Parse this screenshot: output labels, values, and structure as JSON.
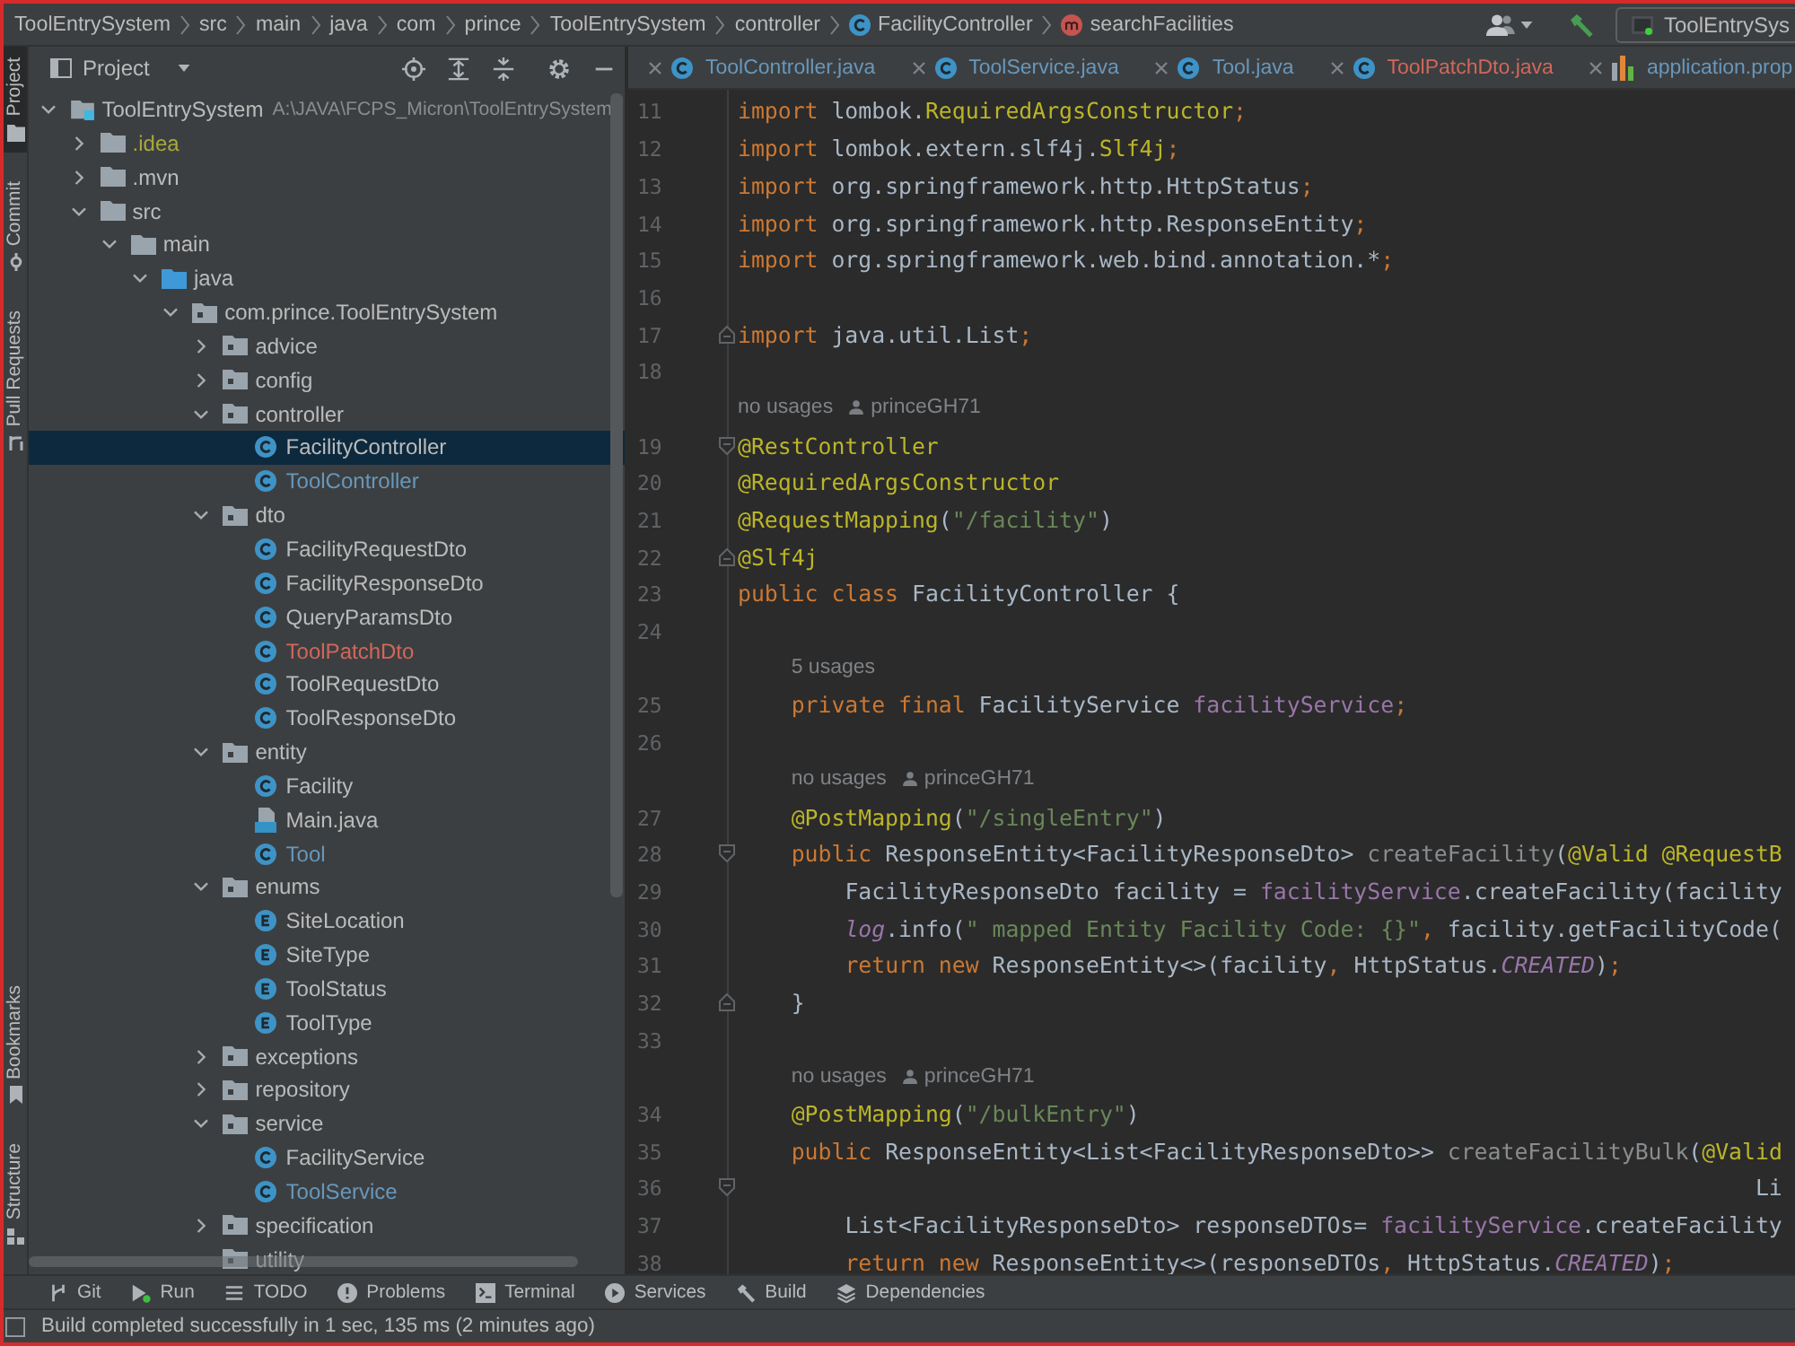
{
  "breadcrumb": {
    "items": [
      {
        "label": "ToolEntrySystem",
        "kind": "path"
      },
      {
        "label": "src",
        "kind": "path"
      },
      {
        "label": "main",
        "kind": "path"
      },
      {
        "label": "java",
        "kind": "path"
      },
      {
        "label": "com",
        "kind": "path"
      },
      {
        "label": "prince",
        "kind": "path"
      },
      {
        "label": "ToolEntrySystem",
        "kind": "path"
      },
      {
        "label": "controller",
        "kind": "path"
      },
      {
        "label": "FacilityController",
        "kind": "class"
      },
      {
        "label": "searchFacilities",
        "kind": "method"
      }
    ],
    "run_configuration": "ToolEntrySys"
  },
  "side_strip": {
    "top": [
      {
        "label": "Project",
        "kind": "project",
        "selected": true
      },
      {
        "label": "Commit",
        "kind": "commit",
        "selected": false
      },
      {
        "label": "Pull Requests",
        "kind": "pull-requests",
        "selected": false
      }
    ],
    "bottom": [
      {
        "label": "Bookmarks",
        "kind": "bookmarks",
        "selected": false
      },
      {
        "label": "Structure",
        "kind": "structure",
        "selected": false
      }
    ]
  },
  "project_panel": {
    "title": "Project",
    "tree": [
      {
        "label": "ToolEntrySystem",
        "path": "A:\\JAVA\\FCPS_Micron\\ToolEntrySystem",
        "kind": "module",
        "expanded": true,
        "selected": false,
        "children": [
          {
            "label": ".idea",
            "kind": "folder",
            "color": "#a8a83a",
            "expanded": false,
            "selected": false
          },
          {
            "label": ".mvn",
            "kind": "folder",
            "expanded": false,
            "selected": false
          },
          {
            "label": "src",
            "kind": "folder",
            "expanded": true,
            "selected": false,
            "children": [
              {
                "label": "main",
                "kind": "folder",
                "expanded": true,
                "selected": false,
                "children": [
                  {
                    "label": "java",
                    "kind": "source-folder",
                    "expanded": true,
                    "selected": false,
                    "children": [
                      {
                        "label": "com.prince.ToolEntrySystem",
                        "kind": "package",
                        "expanded": true,
                        "selected": false,
                        "children": [
                          {
                            "label": "advice",
                            "kind": "package",
                            "expanded": false,
                            "selected": false
                          },
                          {
                            "label": "config",
                            "kind": "package",
                            "expanded": false,
                            "selected": false
                          },
                          {
                            "label": "controller",
                            "kind": "package",
                            "expanded": true,
                            "selected": false,
                            "children": [
                              {
                                "label": "FacilityController",
                                "kind": "class",
                                "selected": true
                              },
                              {
                                "label": "ToolController",
                                "kind": "class",
                                "color": "#6897bb",
                                "selected": false
                              }
                            ]
                          },
                          {
                            "label": "dto",
                            "kind": "package",
                            "expanded": true,
                            "selected": false,
                            "children": [
                              {
                                "label": "FacilityRequestDto",
                                "kind": "class",
                                "selected": false
                              },
                              {
                                "label": "FacilityResponseDto",
                                "kind": "class",
                                "selected": false
                              },
                              {
                                "label": "QueryParamsDto",
                                "kind": "class",
                                "selected": false
                              },
                              {
                                "label": "ToolPatchDto",
                                "kind": "class",
                                "color": "#d1675a",
                                "selected": false
                              },
                              {
                                "label": "ToolRequestDto",
                                "kind": "class",
                                "selected": false
                              },
                              {
                                "label": "ToolResponseDto",
                                "kind": "class",
                                "selected": false
                              }
                            ]
                          },
                          {
                            "label": "entity",
                            "kind": "package",
                            "expanded": true,
                            "selected": false,
                            "children": [
                              {
                                "label": "Facility",
                                "kind": "class",
                                "selected": false
                              },
                              {
                                "label": "Main.java",
                                "kind": "java-file",
                                "selected": false
                              },
                              {
                                "label": "Tool",
                                "kind": "class",
                                "color": "#6897bb",
                                "selected": false
                              }
                            ]
                          },
                          {
                            "label": "enums",
                            "kind": "package",
                            "expanded": true,
                            "selected": false,
                            "children": [
                              {
                                "label": "SiteLocation",
                                "kind": "enum",
                                "selected": false
                              },
                              {
                                "label": "SiteType",
                                "kind": "enum",
                                "selected": false
                              },
                              {
                                "label": "ToolStatus",
                                "kind": "enum",
                                "selected": false
                              },
                              {
                                "label": "ToolType",
                                "kind": "enum",
                                "selected": false
                              }
                            ]
                          },
                          {
                            "label": "exceptions",
                            "kind": "package",
                            "expanded": false,
                            "selected": false
                          },
                          {
                            "label": "repository",
                            "kind": "package",
                            "expanded": false,
                            "selected": false
                          },
                          {
                            "label": "service",
                            "kind": "package",
                            "expanded": true,
                            "selected": false,
                            "children": [
                              {
                                "label": "FacilityService",
                                "kind": "class",
                                "selected": false
                              },
                              {
                                "label": "ToolService",
                                "kind": "class",
                                "color": "#6897bb",
                                "selected": false
                              }
                            ]
                          },
                          {
                            "label": "specification",
                            "kind": "package",
                            "expanded": false,
                            "selected": false
                          },
                          {
                            "label": "utility",
                            "kind": "package",
                            "selected": false
                          }
                        ]
                      }
                    ]
                  }
                ]
              }
            ]
          }
        ]
      }
    ]
  },
  "editor": {
    "tabs": [
      {
        "label": "ToolController.java",
        "kind": "class",
        "color": "#6897bb",
        "selected": false
      },
      {
        "label": "ToolService.java",
        "kind": "class",
        "color": "#6897bb",
        "selected": false
      },
      {
        "label": "Tool.java",
        "kind": "class",
        "color": "#6897bb",
        "selected": false
      },
      {
        "label": "ToolPatchDto.java",
        "kind": "class",
        "color": "#d1675a",
        "selected": false
      },
      {
        "label": "application.prop",
        "kind": "properties",
        "color": "#6897bb",
        "selected": false
      }
    ],
    "lines": [
      {
        "kind": "code",
        "number": "11",
        "tokens": [
          {
            "kind": "kw",
            "text": "import"
          },
          {
            "kind": "plain",
            "text": " lombok."
          },
          {
            "kind": "ann",
            "text": "RequiredArgsConstructor"
          },
          {
            "kind": "kw",
            "text": ";"
          }
        ]
      },
      {
        "kind": "code",
        "number": "12",
        "tokens": [
          {
            "kind": "kw",
            "text": "import"
          },
          {
            "kind": "plain",
            "text": " lombok.extern.slf4j."
          },
          {
            "kind": "ann",
            "text": "Slf4j"
          },
          {
            "kind": "kw",
            "text": ";"
          }
        ]
      },
      {
        "kind": "code",
        "number": "13",
        "tokens": [
          {
            "kind": "kw",
            "text": "import"
          },
          {
            "kind": "plain",
            "text": " org.springframework.http.HttpStatus"
          },
          {
            "kind": "kw",
            "text": ";"
          }
        ]
      },
      {
        "kind": "code",
        "number": "14",
        "tokens": [
          {
            "kind": "kw",
            "text": "import"
          },
          {
            "kind": "plain",
            "text": " org.springframework.http.ResponseEntity"
          },
          {
            "kind": "kw",
            "text": ";"
          }
        ]
      },
      {
        "kind": "code",
        "number": "15",
        "tokens": [
          {
            "kind": "kw",
            "text": "import"
          },
          {
            "kind": "plain",
            "text": " org.springframework.web.bind.annotation.*"
          },
          {
            "kind": "kw",
            "text": ";"
          }
        ]
      },
      {
        "kind": "code",
        "number": "16"
      },
      {
        "kind": "fold-end",
        "number": "17",
        "tokens": [
          {
            "kind": "kw",
            "text": "import"
          },
          {
            "kind": "plain",
            "text": " java.util.List"
          },
          {
            "kind": "kw",
            "text": ";"
          }
        ]
      },
      {
        "kind": "code",
        "number": "18"
      },
      {
        "kind": "hint",
        "usages": "no usages",
        "author": "princeGH71"
      },
      {
        "kind": "fold-start",
        "number": "19",
        "tokens": [
          {
            "kind": "ann",
            "text": "@RestController"
          }
        ]
      },
      {
        "kind": "code",
        "number": "20",
        "tokens": [
          {
            "kind": "ann",
            "text": "@RequiredArgsConstructor"
          }
        ]
      },
      {
        "kind": "code",
        "number": "21",
        "tokens": [
          {
            "kind": "ann",
            "text": "@RequestMapping"
          },
          {
            "kind": "plain",
            "text": "("
          },
          {
            "kind": "str",
            "text": "\"/facility\""
          },
          {
            "kind": "plain",
            "text": ")"
          }
        ]
      },
      {
        "kind": "fold-end",
        "number": "22",
        "tokens": [
          {
            "kind": "ann",
            "text": "@Slf4j"
          }
        ]
      },
      {
        "kind": "code",
        "number": "23",
        "tokens": [
          {
            "kind": "kw",
            "text": "public class"
          },
          {
            "kind": "plain",
            "text": " FacilityController {"
          }
        ]
      },
      {
        "kind": "code",
        "number": "24"
      },
      {
        "kind": "hint",
        "usages": "5 usages"
      },
      {
        "kind": "code",
        "number": "25",
        "tokens": [
          {
            "kind": "kw",
            "text": "    private final"
          },
          {
            "kind": "plain",
            "text": " FacilityService "
          },
          {
            "kind": "field",
            "text": "facilityService"
          },
          {
            "kind": "kw",
            "text": ";"
          }
        ]
      },
      {
        "kind": "code",
        "number": "26"
      },
      {
        "kind": "hint",
        "usages": "no usages",
        "author": "princeGH71"
      },
      {
        "kind": "code",
        "number": "27",
        "tokens": [
          {
            "kind": "ann",
            "text": "    @PostMapping"
          },
          {
            "kind": "plain",
            "text": "("
          },
          {
            "kind": "str",
            "text": "\"/singleEntry\""
          },
          {
            "kind": "plain",
            "text": ")"
          }
        ]
      },
      {
        "kind": "fold-start",
        "number": "28",
        "tokens": [
          {
            "kind": "kw",
            "text": "    public"
          },
          {
            "kind": "plain",
            "text": " ResponseEntity<FacilityResponseDto> "
          },
          {
            "kind": "dim",
            "text": "createFacility"
          },
          {
            "kind": "plain",
            "text": "("
          },
          {
            "kind": "ann",
            "text": "@Valid @RequestB"
          }
        ]
      },
      {
        "kind": "code",
        "number": "29",
        "tokens": [
          {
            "kind": "plain",
            "text": "        FacilityResponseDto facility = "
          },
          {
            "kind": "field",
            "text": "facilityService"
          },
          {
            "kind": "plain",
            "text": ".createFacility(facility"
          }
        ]
      },
      {
        "kind": "code",
        "number": "30",
        "tokens": [
          {
            "kind": "static",
            "text": "        log"
          },
          {
            "kind": "plain",
            "text": ".info("
          },
          {
            "kind": "str",
            "text": "\" mapped Entity Facility Code: {}\""
          },
          {
            "kind": "kw",
            "text": ","
          },
          {
            "kind": "plain",
            "text": " facility.getFacilityCode("
          }
        ]
      },
      {
        "kind": "code",
        "number": "31",
        "tokens": [
          {
            "kind": "kw",
            "text": "        return new"
          },
          {
            "kind": "plain",
            "text": " ResponseEntity<>(facility"
          },
          {
            "kind": "kw",
            "text": ","
          },
          {
            "kind": "plain",
            "text": " HttpStatus."
          },
          {
            "kind": "static",
            "text": "CREATED"
          },
          {
            "kind": "plain",
            "text": ")"
          },
          {
            "kind": "kw",
            "text": ";"
          }
        ]
      },
      {
        "kind": "fold-end",
        "number": "32",
        "tokens": [
          {
            "kind": "plain",
            "text": "    }"
          }
        ]
      },
      {
        "kind": "code",
        "number": "33"
      },
      {
        "kind": "hint",
        "usages": "no usages",
        "author": "princeGH71"
      },
      {
        "kind": "code",
        "number": "34",
        "tokens": [
          {
            "kind": "ann",
            "text": "    @PostMapping"
          },
          {
            "kind": "plain",
            "text": "("
          },
          {
            "kind": "str",
            "text": "\"/bulkEntry\""
          },
          {
            "kind": "plain",
            "text": ")"
          }
        ]
      },
      {
        "kind": "code",
        "number": "35",
        "tokens": [
          {
            "kind": "kw",
            "text": "    public"
          },
          {
            "kind": "plain",
            "text": " ResponseEntity<List<FacilityResponseDto>> "
          },
          {
            "kind": "dim",
            "text": "createFacilityBulk"
          },
          {
            "kind": "plain",
            "text": "("
          },
          {
            "kind": "ann",
            "text": "@Valid"
          }
        ]
      },
      {
        "kind": "fold-start",
        "number": "36",
        "tokens": [
          {
            "kind": "plain",
            "text": "                                                                            Li"
          }
        ]
      },
      {
        "kind": "code",
        "number": "37",
        "tokens": [
          {
            "kind": "plain",
            "text": "        List<FacilityResponseDto> responseDTOs= "
          },
          {
            "kind": "field",
            "text": "facilityService"
          },
          {
            "kind": "plain",
            "text": ".createFacility"
          }
        ]
      },
      {
        "kind": "code",
        "number": "38",
        "tokens": [
          {
            "kind": "kw",
            "text": "        return new"
          },
          {
            "kind": "plain",
            "text": " ResponseEntity<>(responseDTOs"
          },
          {
            "kind": "kw",
            "text": ","
          },
          {
            "kind": "plain",
            "text": " HttpStatus."
          },
          {
            "kind": "static",
            "text": "CREATED"
          },
          {
            "kind": "plain",
            "text": ")"
          },
          {
            "kind": "kw",
            "text": ";"
          }
        ]
      }
    ]
  },
  "tool_windows": [
    {
      "label": "Git",
      "kind": "git"
    },
    {
      "label": "Run",
      "kind": "run"
    },
    {
      "label": "TODO",
      "kind": "todo"
    },
    {
      "label": "Problems",
      "kind": "problems"
    },
    {
      "label": "Terminal",
      "kind": "terminal"
    },
    {
      "label": "Services",
      "kind": "services"
    },
    {
      "label": "Build",
      "kind": "build"
    },
    {
      "label": "Dependencies",
      "kind": "dependencies"
    }
  ],
  "status_bar": {
    "message": "Build completed successfully in 1 sec, 135 ms (2 minutes ago)"
  }
}
